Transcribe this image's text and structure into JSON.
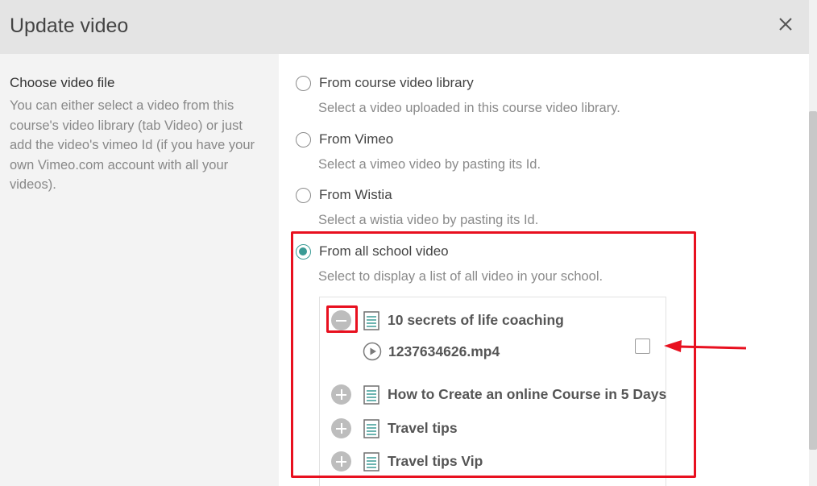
{
  "modal": {
    "title": "Update video"
  },
  "left": {
    "title": "Choose video file",
    "description": "You can either select a video from this course's video library (tab Video) or just add the video's vimeo Id (if you have your own Vimeo.com account with all your videos)."
  },
  "options": [
    {
      "label": "From course video library",
      "description": "Select a video uploaded in this course video library.",
      "checked": false
    },
    {
      "label": "From Vimeo",
      "description": "Select a vimeo video by pasting its Id.",
      "checked": false
    },
    {
      "label": "From Wistia",
      "description": "Select a wistia video by pasting its Id.",
      "checked": false
    },
    {
      "label": "From all school video",
      "description": "Select to display a list of all video in your school.",
      "checked": true
    }
  ],
  "tree": {
    "courses": [
      {
        "name": "10 secrets of life coaching",
        "expanded": true,
        "videos": [
          {
            "file": "1237634626.mp4",
            "selected": false
          }
        ]
      },
      {
        "name": "How to Create an online Course in 5 Days",
        "expanded": false
      },
      {
        "name": "Travel tips",
        "expanded": false
      },
      {
        "name": "Travel tips Vip",
        "expanded": false
      }
    ]
  },
  "colors": {
    "header_bg": "#e4e4e4",
    "left_panel_bg": "#f3f3f3",
    "radio_checked": "#3a9b95",
    "annotation": "#e8101f"
  },
  "icons": {
    "close": "close-icon",
    "toggle_open": "minus-circle-icon",
    "toggle_closed": "plus-circle-icon",
    "course": "list-icon",
    "video": "play-circle-icon"
  }
}
